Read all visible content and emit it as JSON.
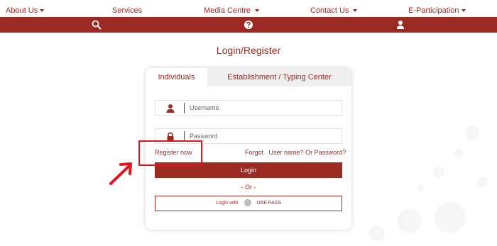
{
  "nav": {
    "about": "About Us",
    "services": "Services",
    "media": "Media Centre",
    "contact": "Contact Us",
    "participation": "E-Participation"
  },
  "icons": {
    "search": "search-icon",
    "help": "question-icon",
    "user": "user-icon"
  },
  "page": {
    "title": "Login/Register"
  },
  "tabs": {
    "individuals": "Individuals",
    "establishment": "Establishment  / Typing Center"
  },
  "form": {
    "username_placeholder": "Username",
    "password_placeholder": "Password",
    "register": "Register now",
    "forgot": "Forgot",
    "username_link": "User name?",
    "or_word": "Or",
    "password_link": "Password?",
    "login": "Login",
    "or_divider": "-   Or   -",
    "login_with": "Login with",
    "uae_pass": "UAE PASS"
  },
  "colors": {
    "brand": "#9b2a22",
    "annotation": "#e0171e"
  }
}
